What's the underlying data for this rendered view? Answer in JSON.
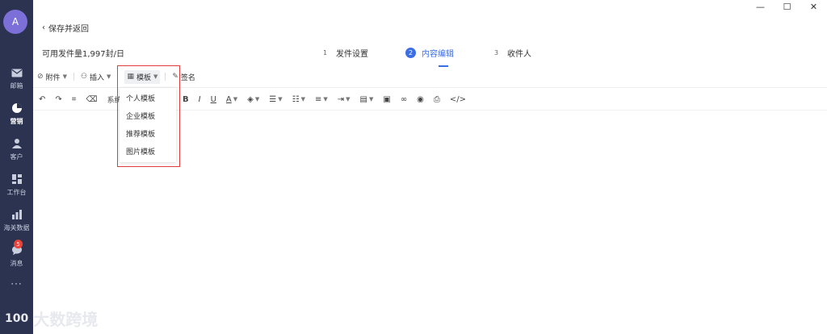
{
  "sidebar": {
    "avatar_letter": "A",
    "items": [
      {
        "label": "邮箱",
        "icon": "mail-icon"
      },
      {
        "label": "营销",
        "icon": "pie-chart-icon",
        "active": true
      },
      {
        "label": "客户",
        "icon": "user-icon"
      },
      {
        "label": "工作台",
        "icon": "dashboard-icon"
      },
      {
        "label": "海关数据",
        "icon": "bar-chart-icon"
      },
      {
        "label": "消息",
        "icon": "chat-icon",
        "badge": "5"
      }
    ],
    "more": "···"
  },
  "window": {
    "minimize": "—",
    "maximize": "☐",
    "close": "✕"
  },
  "header": {
    "back_label": "保存并返回",
    "quota": "可用发件量1,997封/日"
  },
  "steps": [
    {
      "num": "1",
      "label": "发件设置"
    },
    {
      "num": "2",
      "label": "内容编辑",
      "active": true
    },
    {
      "num": "3",
      "label": "收件人"
    }
  ],
  "toolbar1": {
    "attachment": "附件",
    "insert": "插入",
    "template": "模板",
    "signature": "签名",
    "system_partial": "系统"
  },
  "dropdown": {
    "items": [
      "个人模板",
      "企业模板",
      "推荐模板",
      "图片模板"
    ]
  },
  "watermark": {
    "text": "大数跨境",
    "logo": "100"
  }
}
